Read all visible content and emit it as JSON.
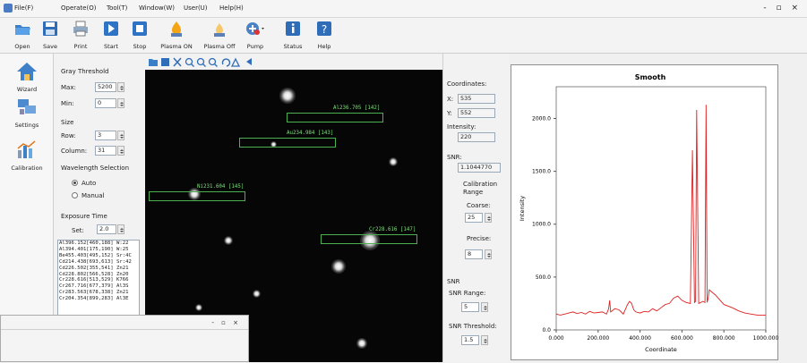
{
  "menu": [
    "File(F)",
    "Operate(O)",
    "Tool(T)",
    "Window(W)",
    "User(U)",
    "Help(H)"
  ],
  "window_controls": "- ▫ ×",
  "toolbar": [
    "Open",
    "Save",
    "Print",
    "Start",
    "Stop",
    "Plasma ON",
    "Plasma Off",
    "Pump",
    "Status",
    "Help"
  ],
  "nav": [
    "Wizard",
    "Settings",
    "Calibration"
  ],
  "gray": {
    "title": "Gray Threshold",
    "max_label": "Max:",
    "max_value": "5200",
    "min_label": "Min:",
    "min_value": "0"
  },
  "size": {
    "title": "Size",
    "row_label": "Row:",
    "row_value": "3",
    "col_label": "Column:",
    "col_value": "31"
  },
  "wavelength": {
    "title": "Wavelength Selection",
    "auto": "Auto",
    "manual": "Manual"
  },
  "exposure": {
    "title": "Exposure Time",
    "set_label": "Set:",
    "set_value": "2.0"
  },
  "peaks": [
    "Al396.152[460,188] W:22",
    "Al394.401[175,190] W:25",
    "Be455.403[495,152] Sr:4C",
    "Cd214.438[693,613] Sr:42",
    "Cd226.502[355,541] Zn21",
    "Cd228.802[566,528] Zn20",
    "Cr228.616[513,529] K766",
    "Cr267.716[677,379] Al3S",
    "Cr283.563[678,338] Zn21",
    "Cr204.354[899,283] Al3E"
  ],
  "rois": [
    {
      "label": "Al236.705 [142]"
    },
    {
      "label": "Au234.984 [143]"
    },
    {
      "label": "Ni231.604 [145]"
    },
    {
      "label": "Cr228.616 [147]"
    }
  ],
  "coord": {
    "title": "Coordinates:",
    "x_label": "X:",
    "x_value": "535",
    "y_label": "Y:",
    "y_value": "552",
    "int_label": "Intensity:",
    "int_value": "220"
  },
  "snr": {
    "title": "SNR:",
    "value": "1.1044770"
  },
  "calib": {
    "title_1": "Calibration",
    "title_2": "Range",
    "coarse_label": "Coarse:",
    "coarse_value": "25",
    "precise_label": "Precise:",
    "precise_value": "8"
  },
  "snr_settings": {
    "title": "SNR",
    "range_label": "SNR Range:",
    "range_value": "5",
    "threshold_label": "SNR Threshold:",
    "threshold_value": "1.5"
  },
  "chart_data": {
    "type": "line",
    "title": "Smooth",
    "xlabel": "Coordinate",
    "ylabel": "Intensity",
    "xlim": [
      0,
      1000
    ],
    "ylim": [
      0,
      2300
    ],
    "x_ticks": [
      "0.000",
      "200.000",
      "400.000",
      "600.000",
      "800.000",
      "1000.000"
    ],
    "y_ticks": [
      "0.0",
      "500.0",
      "1000.0",
      "1500.0",
      "2000.0"
    ],
    "series": [
      {
        "color": "#e02020",
        "x": [
          0,
          20,
          40,
          60,
          80,
          100,
          120,
          140,
          160,
          180,
          200,
          220,
          240,
          250,
          255,
          260,
          280,
          300,
          320,
          340,
          350,
          360,
          370,
          380,
          400,
          420,
          440,
          460,
          480,
          500,
          520,
          540,
          560,
          580,
          600,
          620,
          640,
          650,
          660,
          665,
          670,
          680,
          700,
          710,
          715,
          720,
          725,
          730,
          760,
          800,
          840,
          870,
          900,
          930,
          960,
          1000
        ],
        "y": [
          150,
          140,
          150,
          160,
          170,
          155,
          165,
          150,
          175,
          160,
          165,
          170,
          150,
          200,
          280,
          170,
          200,
          190,
          150,
          240,
          270,
          250,
          190,
          170,
          160,
          175,
          170,
          200,
          180,
          210,
          240,
          250,
          300,
          320,
          280,
          260,
          250,
          1700,
          260,
          270,
          2080,
          250,
          270,
          260,
          2130,
          260,
          300,
          380,
          330,
          240,
          210,
          180,
          160,
          150,
          140,
          140
        ]
      }
    ]
  }
}
